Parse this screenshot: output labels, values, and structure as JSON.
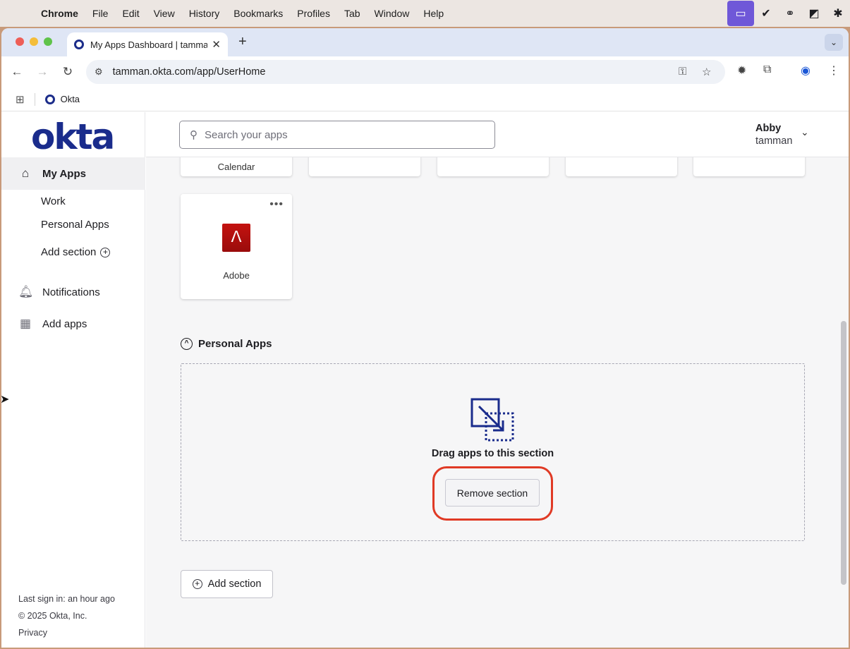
{
  "menubar": {
    "app": "Chrome",
    "items": [
      "File",
      "Edit",
      "View",
      "History",
      "Bookmarks",
      "Profiles",
      "Tab",
      "Window",
      "Help"
    ]
  },
  "browser": {
    "tab_title": "My Apps Dashboard | tamman",
    "url": "tamman.okta.com/app/UserHome",
    "bookmark": "Okta"
  },
  "okta": {
    "logo": "okta",
    "search_placeholder": "Search your apps",
    "user": {
      "first": "Abby",
      "org": "tamman"
    },
    "nav": {
      "my_apps": "My Apps",
      "sections": [
        "Work",
        "Personal Apps"
      ],
      "add_section": "Add section",
      "notifications": "Notifications",
      "add_apps": "Add apps"
    },
    "footer": {
      "last_sign_in": "Last sign in: an hour ago",
      "copyright": "© 2025 Okta, Inc.",
      "privacy": "Privacy"
    },
    "tiles_top": [
      "Calendar",
      "",
      "",
      "",
      ""
    ],
    "adobe_tile": "Adobe",
    "section": {
      "title": "Personal Apps",
      "drag_text": "Drag apps to this section",
      "remove_button": "Remove section"
    },
    "add_section_button": "Add section"
  },
  "colors": {
    "okta_blue": "#1a2c8c",
    "highlight": "#e03a25",
    "adobe_red": "#c4120f"
  }
}
